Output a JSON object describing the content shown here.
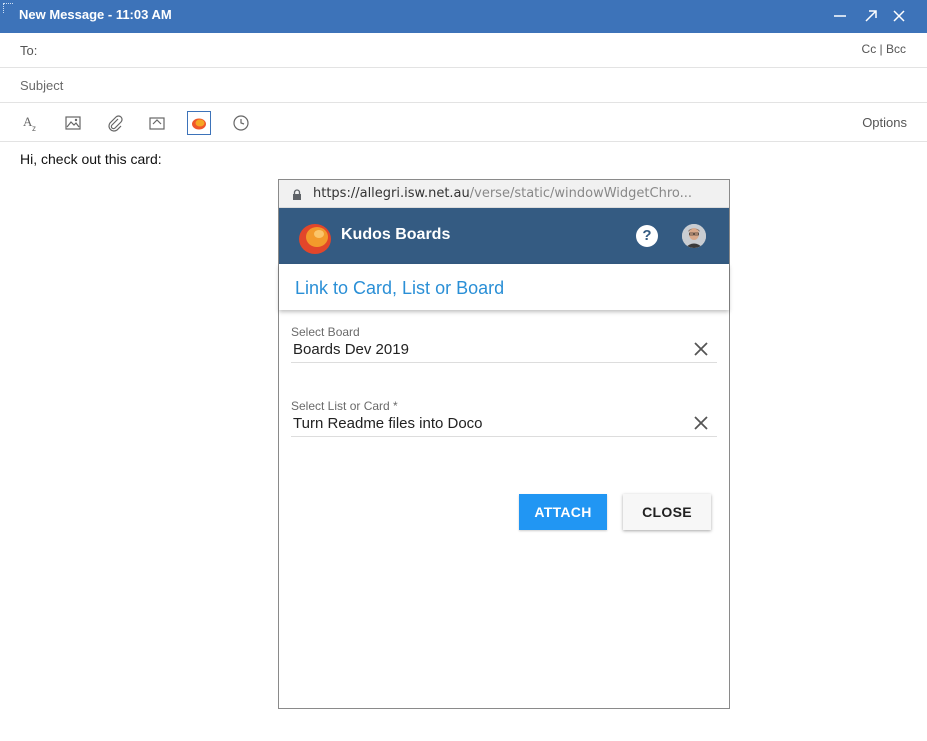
{
  "window": {
    "title": "New Message - 11:03 AM",
    "controls": [
      "minimize-icon",
      "popout-icon",
      "close-icon"
    ]
  },
  "compose": {
    "to_label": "To:",
    "cc_bcc": "Cc | Bcc",
    "subject_label": "Subject",
    "toolbar_icons": [
      "text-format-icon",
      "image-icon",
      "attachment-icon",
      "link-icon",
      "kudos-boards-icon",
      "clock-icon"
    ],
    "options_label": "Options",
    "body_text": "Hi, check out this card:"
  },
  "popup": {
    "url_host": "https://allegri.isw.net.au",
    "url_path": "/verse/static/windowWidgetChro...",
    "app_name": "Kudos Boards",
    "help_label": "?",
    "panel_title": "Link to Card, List or Board",
    "select_board": {
      "label": "Select Board",
      "value": "Boards Dev 2019"
    },
    "select_list": {
      "label": "Select List or Card *",
      "value": "Turn Readme files into Doco"
    },
    "attach_label": "ATTACH",
    "close_label": "CLOSE"
  },
  "colors": {
    "titlebar": "#3d73b9",
    "appbar": "#345b82",
    "accent": "#2196f3",
    "panel_title": "#2a8fd6"
  }
}
